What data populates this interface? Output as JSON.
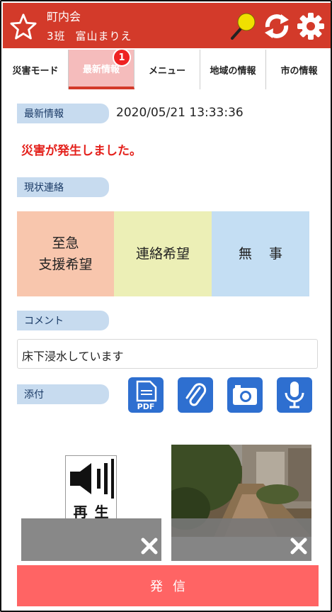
{
  "header": {
    "org_name": "町内会",
    "group": "3班",
    "user_name": "富山まりえ",
    "colors": {
      "bg": "#d33a2a",
      "pin": "#f0e000"
    }
  },
  "tabs": [
    {
      "label": "災害モード"
    },
    {
      "label": "最新情報",
      "active": true,
      "badge": "1"
    },
    {
      "label": "メニュー"
    },
    {
      "label": "地域の情報"
    },
    {
      "label": "市の情報"
    }
  ],
  "latest": {
    "label": "最新情報",
    "timestamp": "2020/05/21 13:33:36",
    "message": "災害が発生しました。"
  },
  "status": {
    "label": "現状連絡",
    "urgent_line1": "至急",
    "urgent_line2": "支援希望",
    "contact": "連絡希望",
    "safe": "無事"
  },
  "comment": {
    "label": "コメント",
    "value": "床下浸水しています"
  },
  "attachments": {
    "label": "添付",
    "icons": [
      "pdf-icon",
      "paperclip-icon",
      "camera-icon",
      "microphone-icon"
    ],
    "pdf_text": "PDF",
    "audio_label": "再生"
  },
  "send_button": "発信"
}
